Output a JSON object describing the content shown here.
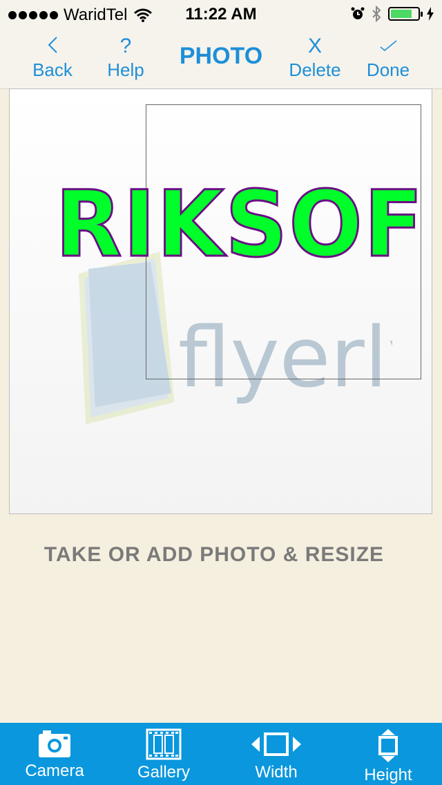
{
  "status_bar": {
    "carrier": "WaridTel",
    "time": "11:22 AM",
    "battery_level": 0.8,
    "icons": [
      "signal-dots",
      "wifi-icon",
      "alarm-icon",
      "bluetooth-icon",
      "battery-icon",
      "charging-icon"
    ]
  },
  "nav": {
    "back": {
      "icon": "‹",
      "label": "Back"
    },
    "help": {
      "icon": "?",
      "label": "Help"
    },
    "title": "PHOTO",
    "delete": {
      "icon": "X",
      "label": "Delete"
    },
    "done": {
      "icon": "✓",
      "label": "Done"
    }
  },
  "canvas": {
    "overlay_text": "RIKSOF",
    "watermark_logo": "flyerly"
  },
  "instruction": "TAKE OR ADD PHOTO & RESIZE",
  "toolbar": {
    "camera": "Camera",
    "gallery": "Gallery",
    "width": "Width",
    "height": "Height"
  },
  "colors": {
    "accent": "#1d8fd8",
    "toolbar_bg": "#0a97dd",
    "page_bg": "#f5efdf",
    "text_green": "#00ff2a",
    "text_outline": "#6a0d84"
  }
}
